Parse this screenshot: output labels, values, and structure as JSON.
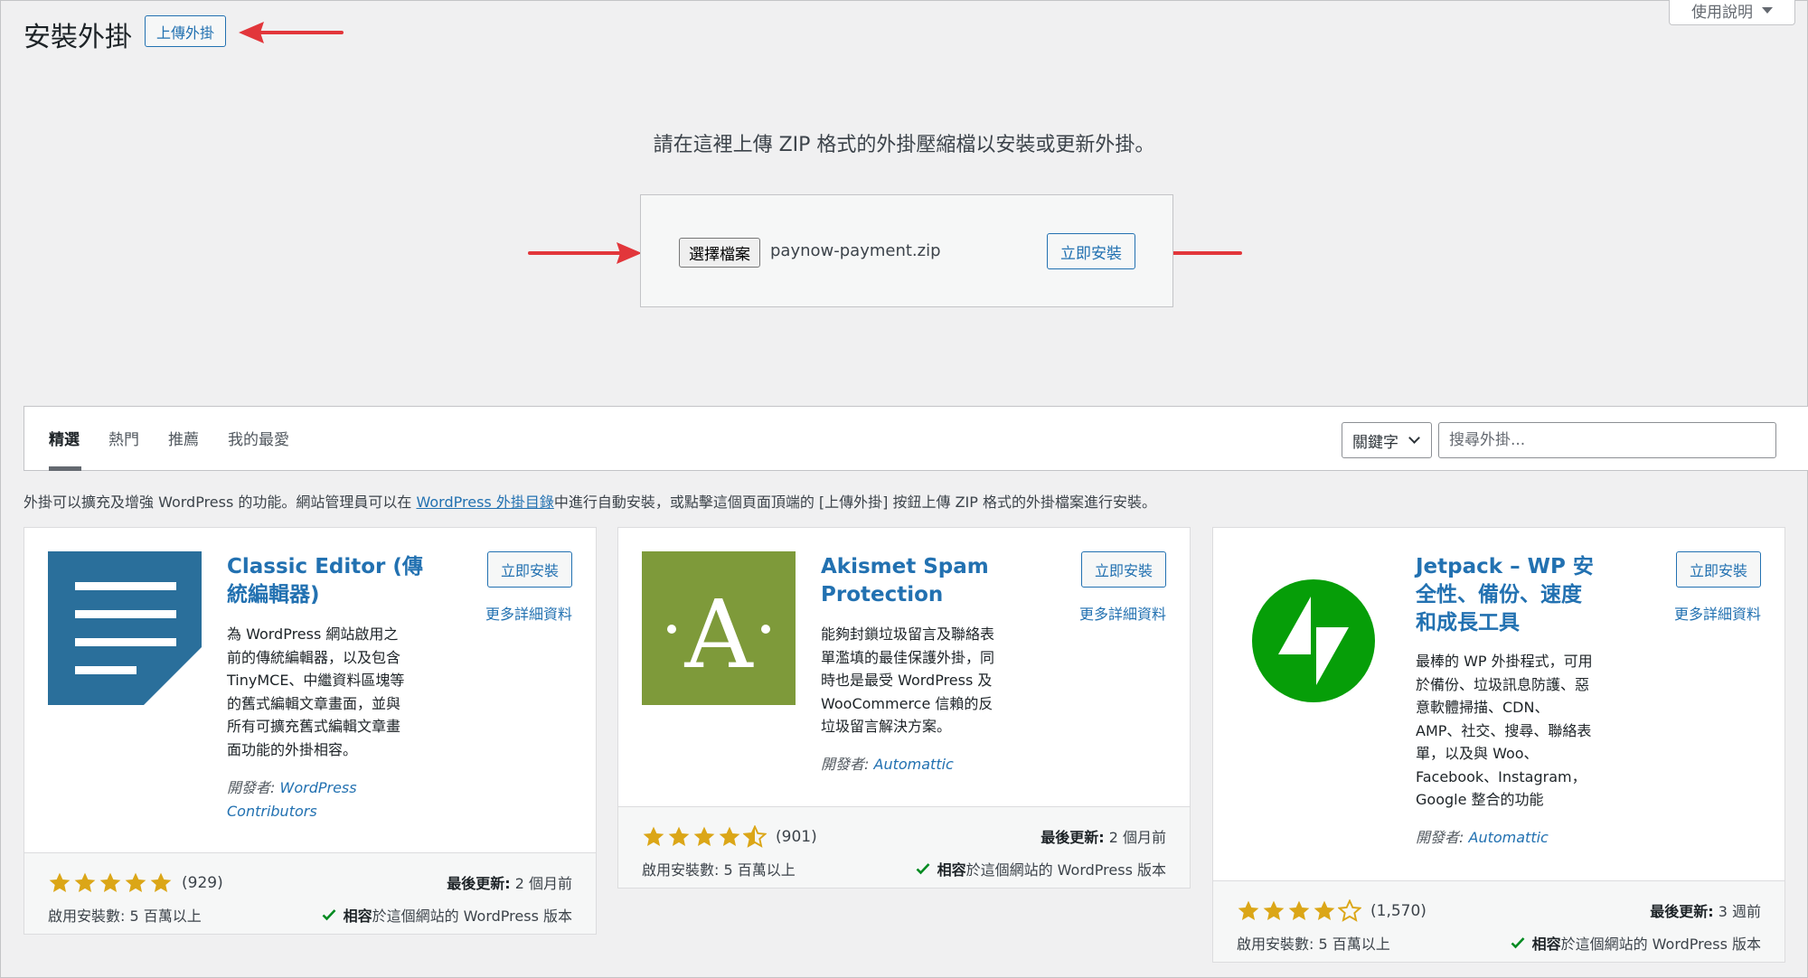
{
  "header": {
    "title": "安裝外掛",
    "upload_button": "上傳外掛",
    "help_tab": "使用說明"
  },
  "upload": {
    "help_text": "請在這裡上傳 ZIP 格式的外掛壓縮檔以安裝或更新外掛。",
    "choose_file_label": "選擇檔案",
    "file_name": "paynow-payment.zip",
    "install_button": "立即安裝"
  },
  "filters": {
    "tabs": [
      {
        "label": "精選",
        "current": true
      },
      {
        "label": "熱門",
        "current": false
      },
      {
        "label": "推薦",
        "current": false
      },
      {
        "label": "我的最愛",
        "current": false
      }
    ],
    "search_type": "關鍵字",
    "search_placeholder": "搜尋外掛..."
  },
  "intro": {
    "before": "外掛可以擴充及增強 WordPress 的功能。網站管理員可以在 ",
    "link": "WordPress 外掛目錄",
    "after": "中進行自動安裝，或點擊這個頁面頂端的 [上傳外掛] 按鈕上傳 ZIP 格式的外掛檔案進行安裝。"
  },
  "plugins": [
    {
      "name_lines": [
        "Classic Editor (傳",
        "統編輯器)"
      ],
      "description_lines": [
        "為 WordPress 網站啟用之",
        "前的傳統編輯器，以及包含",
        "TinyMCE、中繼資料區塊等",
        "的舊式編輯文章畫面，並與",
        "所有可擴充舊式編輯文章畫",
        "面功能的外掛相容。"
      ],
      "author_label": "開發者:",
      "author_lines": [
        "WordPress",
        "Contributors"
      ],
      "install_label": "立即安裝",
      "more_details": "更多詳細資料",
      "rating": 5,
      "rating_count": "(929)",
      "last_updated_label": "最後更新:",
      "last_updated": "2 個月前",
      "installs": "啟用安裝數: 5 百萬以上",
      "compat_strong": "相容",
      "compat_rest": "於這個網站的 WordPress 版本",
      "icon": "classic-editor-document-icon",
      "icon_bg": "#2a6f9b"
    },
    {
      "name_lines": [
        "Akismet Spam",
        "Protection"
      ],
      "description_lines": [
        "能夠封鎖垃圾留言及聯絡表",
        "單濫填的最佳保護外掛，同",
        "時也是最受 WordPress 及",
        "WooCommerce 信賴的反",
        "垃圾留言解決方案。"
      ],
      "author_label": "開發者:",
      "author_lines": [
        "Automattic"
      ],
      "install_label": "立即安裝",
      "more_details": "更多詳細資料",
      "rating": 4.5,
      "rating_count": "(901)",
      "last_updated_label": "最後更新:",
      "last_updated": "2 個月前",
      "installs": "啟用安裝數: 5 百萬以上",
      "compat_strong": "相容",
      "compat_rest": "於這個網站的 WordPress 版本",
      "icon": "akismet-letter-a-icon",
      "icon_bg": "#7e9a3a"
    },
    {
      "name_lines": [
        "Jetpack – WP 安",
        "全性、備份、速度",
        "和成長工具"
      ],
      "description_lines": [
        "最棒的 WP 外掛程式，可用",
        "於備份、垃圾訊息防護、惡",
        "意軟體掃描、CDN、",
        "AMP、社交、搜尋、聯絡表",
        "單，以及與 Woo、",
        "Facebook、Instagram，",
        "Google 整合的功能"
      ],
      "author_label": "開發者:",
      "author_lines": [
        "Automattic"
      ],
      "install_label": "立即安裝",
      "more_details": "更多詳細資料",
      "rating": 4,
      "rating_count": "(1,570)",
      "last_updated_label": "最後更新:",
      "last_updated": "3 週前",
      "installs": "啟用安裝數: 5 百萬以上",
      "compat_strong": "相容",
      "compat_rest": "於這個網站的 WordPress 版本",
      "icon": "jetpack-bolt-icon",
      "icon_bg": "#069e08"
    }
  ],
  "colors": {
    "accent": "#2271b1",
    "star": "#dba617",
    "arrow": "#e2363b"
  }
}
